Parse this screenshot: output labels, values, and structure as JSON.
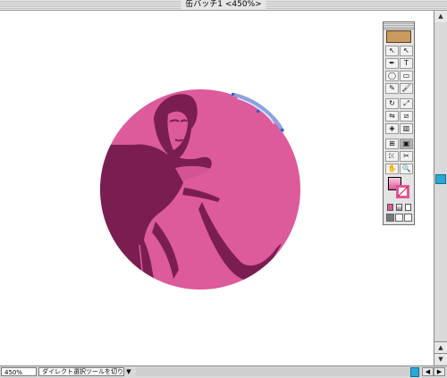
{
  "window": {
    "title": "缶バッチ1 <450%>"
  },
  "status_bar": {
    "zoom": "450%",
    "tool_status": "ダイレクト選択ツールを切り換え",
    "tool_status_arrow": "▼"
  },
  "scrollbars": {
    "up_arrow": "▲",
    "down_arrow": "▼",
    "left_arrow": "◀",
    "right_arrow": "▶"
  },
  "toolbox": {
    "tools": [
      {
        "name": "selection-tool-icon",
        "glyph": "↖"
      },
      {
        "name": "direct-selection-tool-icon",
        "glyph": "↖"
      },
      {
        "name": "pen-tool-icon",
        "glyph": "✒"
      },
      {
        "name": "type-tool-icon",
        "glyph": "T"
      },
      {
        "name": "ellipse-tool-icon",
        "glyph": "◯"
      },
      {
        "name": "rectangle-tool-icon",
        "glyph": "▭"
      },
      {
        "name": "pencil-tool-icon",
        "glyph": "✎"
      },
      {
        "name": "brush-tool-icon",
        "glyph": "🖌"
      },
      {
        "name": "rotate-tool-icon",
        "glyph": "↻"
      },
      {
        "name": "scale-tool-icon",
        "glyph": "⤢"
      },
      {
        "name": "reflect-tool-icon",
        "glyph": "⇋"
      },
      {
        "name": "shear-tool-icon",
        "glyph": "⧄"
      },
      {
        "name": "blend-tool-icon",
        "glyph": "◈"
      },
      {
        "name": "graph-tool-icon",
        "glyph": "▥"
      },
      {
        "name": "mesh-tool-icon",
        "glyph": "⊞"
      },
      {
        "name": "gradient-tool-icon",
        "glyph": "▣"
      },
      {
        "name": "eyedropper-tool-icon",
        "glyph": "⤪"
      },
      {
        "name": "scissors-tool-icon",
        "glyph": "✂"
      },
      {
        "name": "hand-tool-icon",
        "glyph": "✋"
      },
      {
        "name": "zoom-tool-icon",
        "glyph": "🔍"
      }
    ]
  },
  "colors": {
    "badge_pink": "#dd5a9b",
    "figure_dark": "#7a1e52",
    "highlight_blue": "#8aa2e0",
    "scroll_thumb": "#2aa7d6"
  }
}
